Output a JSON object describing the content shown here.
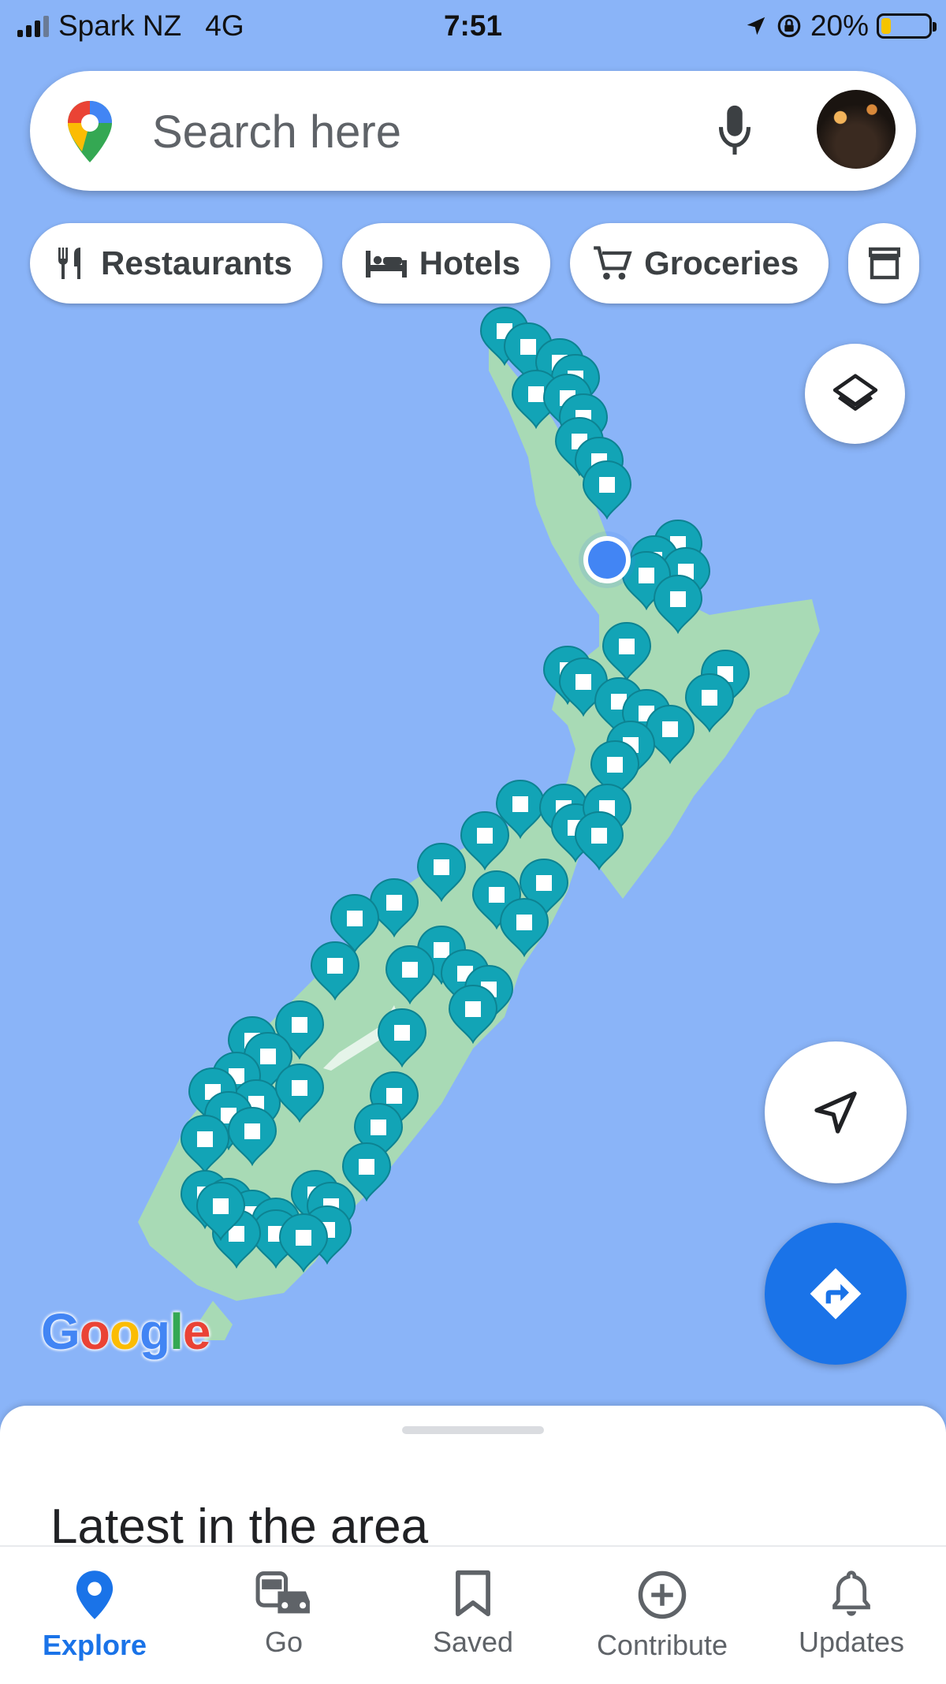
{
  "status_bar": {
    "carrier": "Spark NZ",
    "network": "4G",
    "time": "7:51",
    "battery": "20%",
    "battery_level": 0.2
  },
  "search": {
    "placeholder": "Search here"
  },
  "chips": [
    {
      "label": "Restaurants",
      "icon": "fork-knife-icon"
    },
    {
      "label": "Hotels",
      "icon": "bed-icon"
    },
    {
      "label": "Groceries",
      "icon": "cart-icon"
    }
  ],
  "map": {
    "watermark": "Google",
    "region": "New Zealand"
  },
  "sheet": {
    "title": "Latest in the area"
  },
  "nav": [
    {
      "label": "Explore",
      "icon": "explore-pin-icon"
    },
    {
      "label": "Go",
      "icon": "commute-icon"
    },
    {
      "label": "Saved",
      "icon": "bookmark-icon"
    },
    {
      "label": "Contribute",
      "icon": "add-circle-icon"
    },
    {
      "label": "Updates",
      "icon": "bell-icon"
    }
  ],
  "colors": {
    "water": "#8ab4f8",
    "land": "#a8dab5",
    "marker": "#12a4b6",
    "accent": "#1a73e8"
  }
}
